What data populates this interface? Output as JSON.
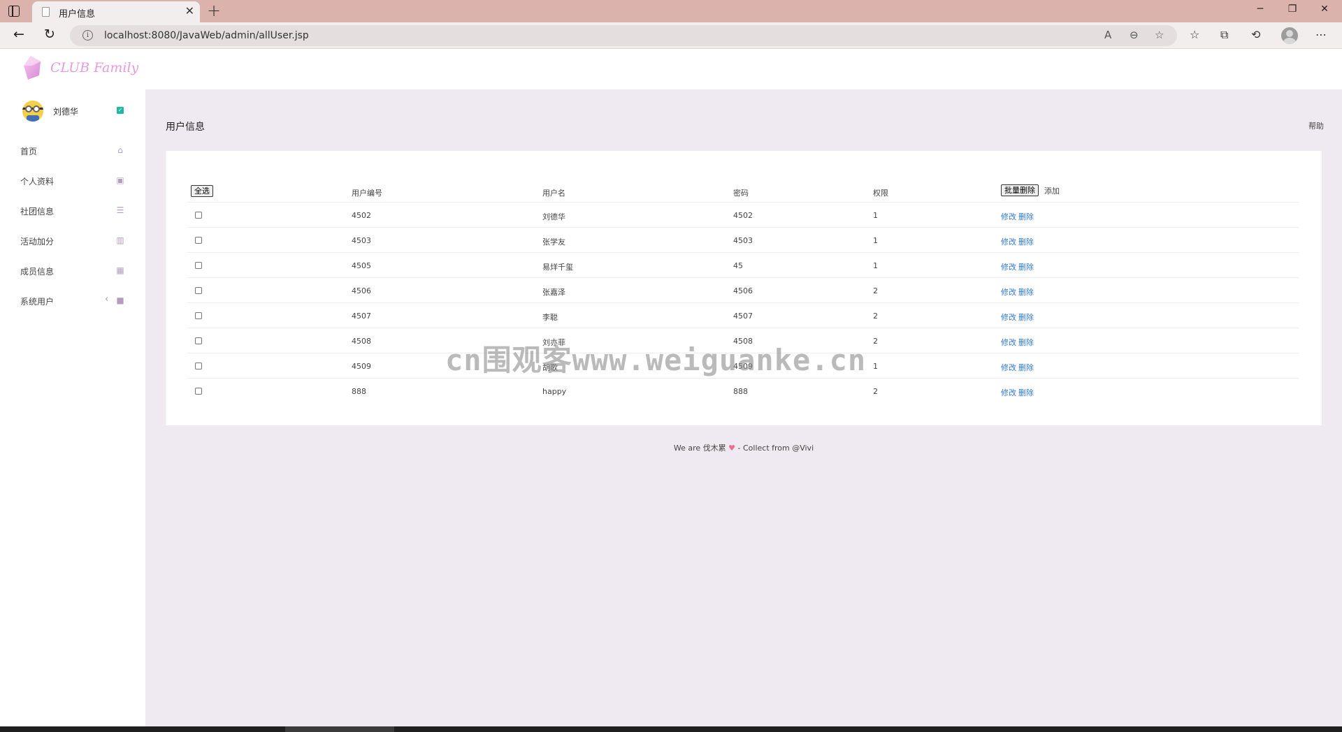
{
  "browser": {
    "tab_title": "用户信息",
    "url": "localhost:8080/JavaWeb/admin/allUser.jsp"
  },
  "app": {
    "logo_text": "CLUB Family",
    "user_name": "刘德华",
    "nav": [
      {
        "label": "首页",
        "icon": "home-icon"
      },
      {
        "label": "个人资料",
        "icon": "address-card-icon"
      },
      {
        "label": "社团信息",
        "icon": "list-icon"
      },
      {
        "label": "活动加分",
        "icon": "bar-chart-icon"
      },
      {
        "label": "成员信息",
        "icon": "table-icon"
      },
      {
        "label": "系统用户",
        "icon": "briefcase-icon"
      }
    ],
    "page_title": "用户信息",
    "help_label": "帮助"
  },
  "table": {
    "select_all_label": "全选",
    "headers": {
      "id": "用户编号",
      "username": "用户名",
      "password": "密码",
      "permission": "权限"
    },
    "batch_delete_label": "批量删除",
    "add_label": "添加",
    "edit_label": "修改",
    "delete_label": "删除",
    "rows": [
      {
        "id": "4502",
        "username": "刘德华",
        "password": "4502",
        "permission": "1"
      },
      {
        "id": "4503",
        "username": "张学友",
        "password": "4503",
        "permission": "1"
      },
      {
        "id": "4505",
        "username": "易烊千玺",
        "password": "45",
        "permission": "1"
      },
      {
        "id": "4506",
        "username": "张嘉泽",
        "password": "4506",
        "permission": "2"
      },
      {
        "id": "4507",
        "username": "李聪",
        "password": "4507",
        "permission": "2"
      },
      {
        "id": "4508",
        "username": "刘亦菲",
        "password": "4508",
        "permission": "2"
      },
      {
        "id": "4509",
        "username": "胡歌",
        "password": "4509",
        "permission": "1"
      },
      {
        "id": "888",
        "username": "happy",
        "password": "888",
        "permission": "2"
      }
    ]
  },
  "footer": {
    "prefix": "We are 伐木累",
    "suffix": " - Collect from @Vivi"
  },
  "watermark": "cn围观客www.weiguanke.cn",
  "colors": {
    "accent_link": "#2c79d8",
    "main_bg": "#efeaf1",
    "tabbar_bg": "#dbb2ac",
    "logo_pink": "#e79ae0"
  }
}
